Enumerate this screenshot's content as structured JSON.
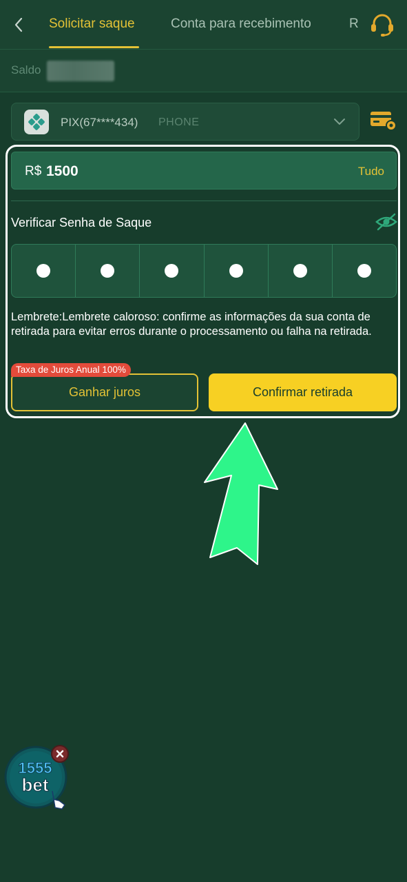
{
  "header": {
    "tabs": [
      {
        "label": "Solicitar saque",
        "active": true
      },
      {
        "label": "Conta para recebimento",
        "active": false
      },
      {
        "label": "R",
        "active": false
      }
    ]
  },
  "balance": {
    "label": "Saldo"
  },
  "account": {
    "label": "PIX(67****434)",
    "type": "PHONE"
  },
  "amount": {
    "currency": "R$",
    "value": "1500",
    "all_label": "Tudo"
  },
  "password": {
    "label": "Verificar Senha de Saque",
    "digits_entered": 6
  },
  "reminder": "Lembrete:Lembrete caloroso: confirme as informações da sua conta de retirada para evitar erros durante o processamento ou falha na retirada.",
  "actions": {
    "interest_badge": "Taxa de Juros Anual 100%",
    "interest_label": "Ganhar juros",
    "confirm_label": "Confirmar retirada"
  },
  "floating_logo": {
    "line1": "1555",
    "line2": "bet"
  },
  "colors": {
    "background": "#173d2c",
    "accent": "#e3c236",
    "confirm": "#f7d023",
    "badge": "#e34b3b",
    "arrow": "#2ef58a"
  }
}
